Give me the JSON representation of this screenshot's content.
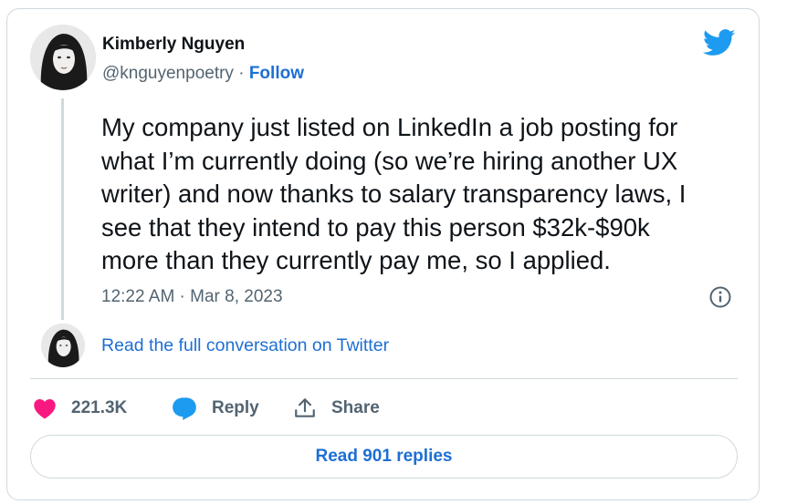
{
  "author": {
    "name": "Kimberly Nguyen",
    "handle": "@knguyenpoetry",
    "separator": "·",
    "follow_label": "Follow"
  },
  "tweet": {
    "lines": [
      "My company just listed on LinkedIn a job posting for",
      "what I’m currently doing (so we’re hiring another UX",
      "writer) and now thanks to salary transparency laws, I",
      "see that they intend to pay this person $32k-$90k",
      "more than they currently pay me, so I applied."
    ],
    "timestamp": "12:22 AM · Mar 8, 2023"
  },
  "conversation": {
    "link_label": "Read the full conversation on Twitter"
  },
  "actions": {
    "like_count": "221.3K",
    "reply_label": "Reply",
    "share_label": "Share"
  },
  "replies_button": {
    "label": "Read 901 replies"
  },
  "colors": {
    "accent": "#1d6fd3",
    "twitter_blue": "#1d9bf0",
    "like": "#f91880",
    "border": "#cfd9de",
    "muted": "#536471"
  },
  "icons": {
    "logo": "twitter-bird-icon",
    "info": "info-icon",
    "like": "heart-icon",
    "reply": "speech-bubble-icon",
    "share": "share-upload-icon"
  }
}
